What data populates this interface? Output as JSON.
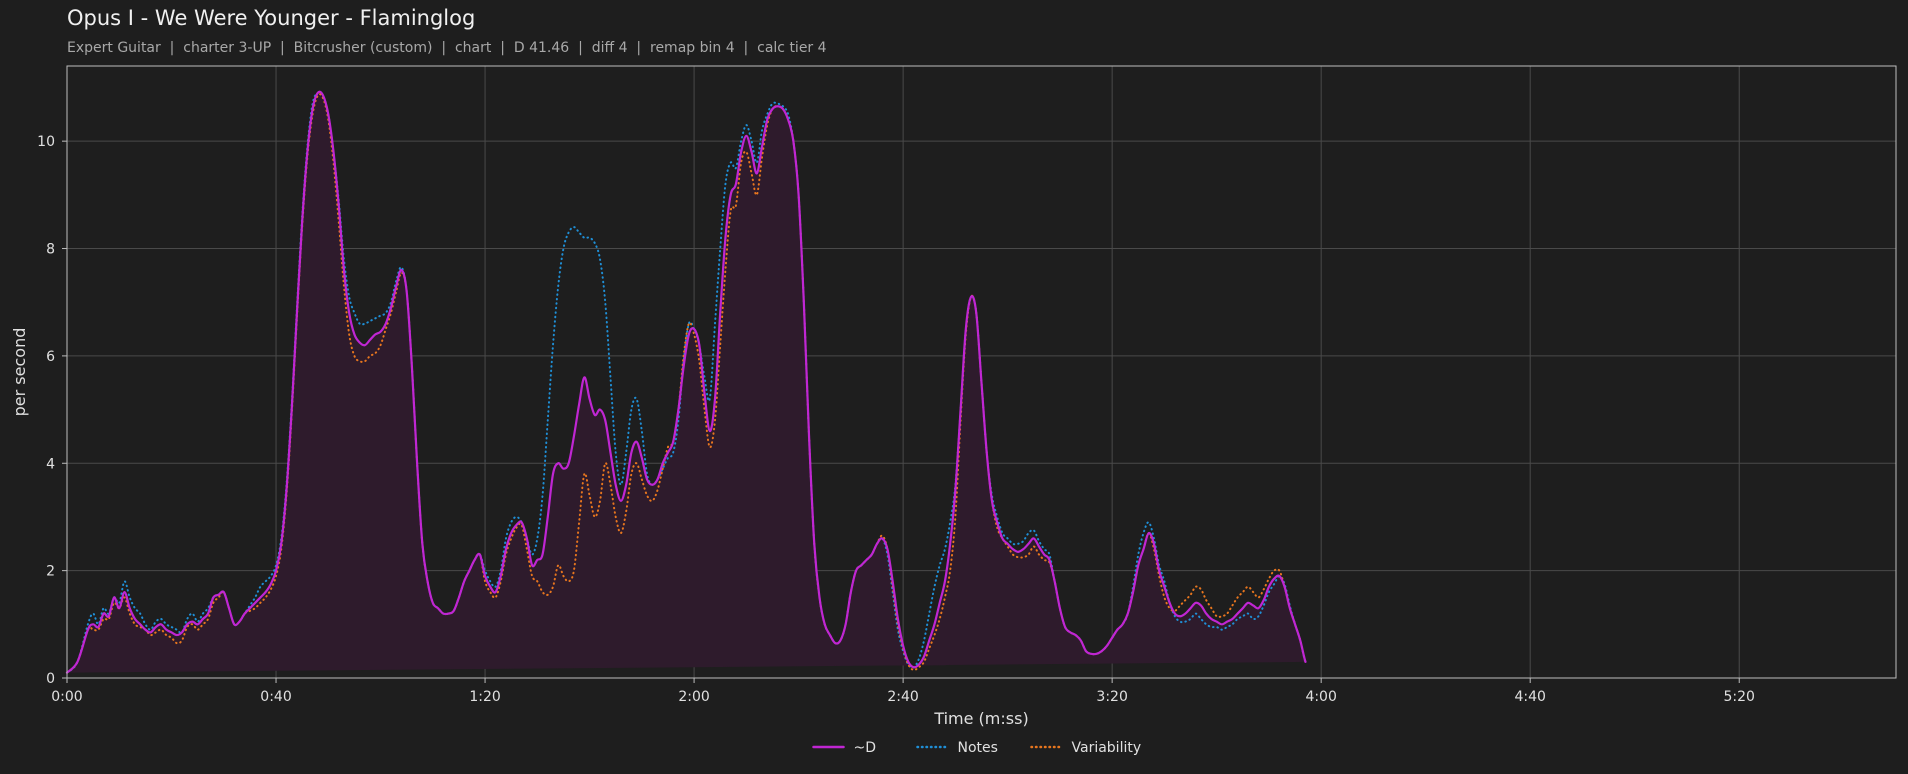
{
  "title": "Opus I - We Were Younger - Flaminglog",
  "subtitle": "Expert Guitar  |  charter 3-UP  |  Bitcrusher (custom)  |  chart  |  D 41.46  |  diff 4  |  remap bin 4  |  calc tier 4",
  "colors": {
    "background": "#1e1e1e",
    "grid": "#4a4a4a",
    "axis": "#bdbdbd",
    "d": "#c026d3",
    "d_fill": "#2e1b2c",
    "notes": "#1f8fd6",
    "variability": "#e8761e"
  },
  "chart_data": {
    "type": "line",
    "xlabel": "Time (m:ss)",
    "ylabel": "per second",
    "xlim": [
      0,
      350
    ],
    "ylim": [
      0,
      11.4
    ],
    "x_ticks": [
      0,
      40,
      80,
      120,
      160,
      200,
      240,
      280,
      320
    ],
    "x_tick_labels": [
      "0:00",
      "0:40",
      "1:20",
      "2:00",
      "2:40",
      "3:20",
      "4:00",
      "4:40",
      "5:20"
    ],
    "y_ticks": [
      0,
      2,
      4,
      6,
      8,
      10
    ],
    "y_tick_labels": [
      "0",
      "2",
      "4",
      "6",
      "8",
      "10"
    ],
    "grid": true,
    "legend_position": "bottom-center",
    "x": [
      0,
      2,
      4,
      5,
      6,
      7,
      8,
      9,
      10,
      11,
      12,
      13,
      14,
      15,
      16,
      17,
      18,
      19,
      20,
      21,
      22,
      23,
      24,
      25,
      26,
      27,
      28,
      29,
      30,
      31,
      32,
      33,
      34,
      35,
      36,
      37,
      38,
      39,
      40,
      41,
      42,
      43,
      44,
      45,
      46,
      47,
      48,
      49,
      50,
      51,
      52,
      53,
      54,
      55,
      56,
      57,
      58,
      59,
      60,
      61,
      62,
      63,
      64,
      65,
      66,
      67,
      68,
      69,
      70,
      71,
      72,
      73,
      74,
      75,
      76,
      77,
      78,
      79,
      80,
      81,
      82,
      83,
      84,
      85,
      86,
      87,
      88,
      89,
      90,
      91,
      92,
      93,
      94,
      95,
      96,
      97,
      98,
      99,
      100,
      101,
      102,
      103,
      104,
      105,
      106,
      107,
      108,
      109,
      110,
      111,
      112,
      113,
      114,
      115,
      116,
      117,
      118,
      119,
      120,
      121,
      122,
      123,
      124,
      125,
      126,
      127,
      128,
      129,
      130,
      131,
      132,
      133,
      134,
      135,
      136,
      137,
      138,
      139,
      140,
      141,
      142,
      143,
      144,
      145,
      146,
      147,
      148,
      149,
      150,
      151,
      152,
      153,
      154,
      155,
      156,
      157,
      158,
      159,
      160,
      161,
      162,
      163,
      164,
      165,
      166,
      167,
      168,
      169,
      170,
      171,
      172,
      173,
      174,
      175,
      176,
      177,
      178,
      179,
      180,
      181,
      182,
      183,
      184,
      185,
      186,
      187,
      188,
      189,
      190,
      191,
      192,
      193,
      194,
      195,
      196,
      197,
      198,
      199,
      200,
      201,
      202,
      203,
      204,
      205,
      206,
      207,
      208,
      209,
      210,
      211,
      212,
      213,
      214,
      215,
      216,
      217,
      218,
      219,
      220,
      221,
      222,
      223,
      224,
      225,
      226,
      227,
      228,
      229,
      230,
      231,
      232,
      233,
      234,
      235,
      236,
      237,
      238,
      239,
      240,
      241,
      242,
      243,
      244,
      245,
      246,
      247,
      248,
      249,
      250,
      251,
      252,
      253,
      254,
      255,
      256,
      257,
      258,
      259,
      260,
      261,
      262,
      263,
      264,
      265,
      266,
      267,
      268,
      269,
      270,
      271,
      272,
      273,
      274,
      275,
      276,
      277,
      278,
      279,
      280,
      281,
      282,
      283,
      284,
      285,
      286,
      287,
      288,
      289,
      290,
      291,
      292,
      293,
      294,
      295,
      296,
      297,
      298,
      299,
      300,
      301,
      302,
      303,
      304,
      305,
      306,
      307,
      308,
      309,
      310,
      311,
      312,
      313,
      314,
      315,
      316,
      317,
      318,
      319,
      320,
      321,
      322,
      323,
      324,
      325,
      326,
      327,
      328,
      329,
      330,
      331,
      332,
      333,
      334,
      335,
      336,
      337,
      338,
      339,
      340,
      341,
      342,
      343,
      344,
      345,
      346,
      347,
      348,
      349,
      350
    ],
    "series": [
      {
        "name": "~D",
        "style": "solid",
        "values": [
          0.1,
          0.3,
          0.9,
          1.0,
          0.95,
          1.2,
          1.15,
          1.5,
          1.3,
          1.6,
          1.3,
          1.1,
          1.0,
          0.9,
          0.85,
          0.95,
          1.0,
          0.9,
          0.85,
          0.8,
          0.85,
          1.0,
          1.05,
          1.0,
          1.1,
          1.2,
          1.5,
          1.55,
          1.6,
          1.3,
          1.0,
          1.05,
          1.2,
          1.3,
          1.4,
          1.5,
          1.6,
          1.75,
          2.0,
          2.5,
          3.5,
          5.0,
          6.8,
          8.5,
          9.8,
          10.6,
          10.9,
          10.85,
          10.5,
          9.8,
          8.8,
          7.6,
          6.8,
          6.4,
          6.25,
          6.2,
          6.3,
          6.4,
          6.45,
          6.6,
          6.9,
          7.3,
          7.6,
          7.2,
          5.8,
          4.0,
          2.5,
          1.8,
          1.4,
          1.3,
          1.2,
          1.2,
          1.25,
          1.5,
          1.8,
          2.0,
          2.2,
          2.3,
          1.9,
          1.7,
          1.6,
          1.9,
          2.4,
          2.7,
          2.85,
          2.9,
          2.6,
          2.1,
          2.2,
          2.3,
          3.0,
          3.8,
          4.0,
          3.9,
          4.0,
          4.5,
          5.1,
          5.6,
          5.2,
          4.9,
          5.0,
          4.8,
          4.2,
          3.6,
          3.3,
          3.6,
          4.2,
          4.4,
          4.1,
          3.7,
          3.6,
          3.7,
          4.0,
          4.2,
          4.4,
          5.0,
          5.8,
          6.4,
          6.5,
          6.2,
          5.3,
          4.6,
          5.2,
          6.8,
          8.2,
          9.0,
          9.2,
          9.8,
          10.1,
          9.8,
          9.4,
          9.9,
          10.4,
          10.6,
          10.65,
          10.6,
          10.4,
          10.0,
          9.0,
          7.0,
          4.5,
          2.5,
          1.5,
          1.0,
          0.8,
          0.65,
          0.7,
          1.0,
          1.6,
          2.0,
          2.1,
          2.2,
          2.3,
          2.5,
          2.6,
          2.4,
          1.8,
          1.1,
          0.6,
          0.3,
          0.2,
          0.25,
          0.4,
          0.7,
          1.0,
          1.4,
          1.8,
          2.5,
          3.5,
          5.0,
          6.5,
          7.1,
          6.8,
          5.5,
          4.2,
          3.3,
          2.9,
          2.6,
          2.5,
          2.4,
          2.35,
          2.4,
          2.5,
          2.6,
          2.45,
          2.3,
          2.2,
          1.8,
          1.3,
          0.95,
          0.85,
          0.8,
          0.7,
          0.5,
          0.45,
          0.45,
          0.5,
          0.6,
          0.75,
          0.9,
          1.0,
          1.2,
          1.6,
          2.1,
          2.4,
          2.7,
          2.5,
          2.0,
          1.7,
          1.4,
          1.2,
          1.15,
          1.2,
          1.3,
          1.4,
          1.35,
          1.2,
          1.1,
          1.05,
          1.0,
          1.05,
          1.1,
          1.2,
          1.3,
          1.4,
          1.35,
          1.3,
          1.45,
          1.7,
          1.85,
          1.9,
          1.7,
          1.3,
          1.0,
          0.7,
          0.3,
          0.1
        ]
      },
      {
        "name": "Notes",
        "style": "dotted",
        "values": [
          0.1,
          0.3,
          1.0,
          1.2,
          1.0,
          1.3,
          1.2,
          1.5,
          1.4,
          1.8,
          1.5,
          1.3,
          1.2,
          1.0,
          0.9,
          1.05,
          1.1,
          1.0,
          0.95,
          0.9,
          0.85,
          1.1,
          1.2,
          1.05,
          1.2,
          1.3,
          1.5,
          1.55,
          1.6,
          1.3,
          1.0,
          1.05,
          1.2,
          1.35,
          1.5,
          1.7,
          1.8,
          1.9,
          2.1,
          2.6,
          3.6,
          5.1,
          6.9,
          8.6,
          9.9,
          10.7,
          10.9,
          10.85,
          10.5,
          9.8,
          8.9,
          7.8,
          7.1,
          6.8,
          6.6,
          6.6,
          6.65,
          6.7,
          6.75,
          6.8,
          7.0,
          7.4,
          7.65,
          7.2,
          5.8,
          4.0,
          2.5,
          1.8,
          1.4,
          1.3,
          1.2,
          1.2,
          1.25,
          1.5,
          1.8,
          2.0,
          2.2,
          2.3,
          2.0,
          1.8,
          1.7,
          2.0,
          2.6,
          2.9,
          3.0,
          2.9,
          2.6,
          2.3,
          2.6,
          3.4,
          4.8,
          6.2,
          7.3,
          8.0,
          8.3,
          8.4,
          8.3,
          8.2,
          8.2,
          8.1,
          7.8,
          7.0,
          5.6,
          4.2,
          3.6,
          4.2,
          5.0,
          5.2,
          4.6,
          3.8,
          3.6,
          3.7,
          3.9,
          4.1,
          4.2,
          4.8,
          5.9,
          6.6,
          6.5,
          6.2,
          5.6,
          5.2,
          6.6,
          8.0,
          9.2,
          9.6,
          9.5,
          10.0,
          10.3,
          10.0,
          9.6,
          10.2,
          10.5,
          10.7,
          10.7,
          10.65,
          10.5,
          10.0,
          9.0,
          7.0,
          4.5,
          2.5,
          1.5,
          1.0,
          0.8,
          0.65,
          0.7,
          1.0,
          1.6,
          2.0,
          2.1,
          2.2,
          2.3,
          2.5,
          2.6,
          2.3,
          1.6,
          0.9,
          0.5,
          0.25,
          0.2,
          0.35,
          0.7,
          1.2,
          1.7,
          2.1,
          2.4,
          2.9,
          3.6,
          5.0,
          6.5,
          7.1,
          6.8,
          5.5,
          4.2,
          3.4,
          3.0,
          2.7,
          2.6,
          2.5,
          2.5,
          2.55,
          2.7,
          2.75,
          2.55,
          2.4,
          2.3,
          1.8,
          1.3,
          0.95,
          0.85,
          0.8,
          0.7,
          0.5,
          0.45,
          0.45,
          0.5,
          0.6,
          0.75,
          0.9,
          1.0,
          1.2,
          1.7,
          2.3,
          2.7,
          2.9,
          2.6,
          2.1,
          1.8,
          1.4,
          1.15,
          1.05,
          1.05,
          1.1,
          1.2,
          1.1,
          1.0,
          0.95,
          0.95,
          0.9,
          0.95,
          1.0,
          1.1,
          1.15,
          1.2,
          1.1,
          1.15,
          1.35,
          1.6,
          1.75,
          1.9,
          1.75,
          1.35,
          1.0,
          0.7,
          0.3,
          0.25
        ]
      },
      {
        "name": "Variability",
        "style": "dotted",
        "values": [
          0.1,
          0.3,
          0.9,
          0.9,
          0.9,
          1.1,
          1.1,
          1.4,
          1.3,
          1.5,
          1.2,
          1.0,
          0.95,
          0.9,
          0.8,
          0.85,
          0.9,
          0.8,
          0.75,
          0.65,
          0.7,
          0.95,
          1.0,
          0.9,
          1.0,
          1.1,
          1.4,
          1.5,
          1.6,
          1.3,
          1.0,
          1.05,
          1.2,
          1.25,
          1.3,
          1.4,
          1.5,
          1.65,
          1.9,
          2.4,
          3.4,
          4.9,
          6.7,
          8.4,
          9.7,
          10.5,
          10.85,
          10.8,
          10.4,
          9.6,
          8.5,
          7.3,
          6.4,
          6.0,
          5.9,
          5.9,
          6.0,
          6.05,
          6.2,
          6.5,
          6.8,
          7.2,
          7.55,
          7.2,
          5.8,
          4.0,
          2.5,
          1.8,
          1.4,
          1.3,
          1.2,
          1.2,
          1.25,
          1.5,
          1.8,
          2.0,
          2.2,
          2.3,
          1.8,
          1.6,
          1.5,
          1.8,
          2.3,
          2.6,
          2.8,
          2.85,
          2.4,
          1.9,
          1.8,
          1.6,
          1.55,
          1.7,
          2.1,
          1.9,
          1.8,
          2.0,
          2.9,
          3.8,
          3.4,
          3.0,
          3.3,
          4.0,
          3.6,
          3.0,
          2.7,
          3.1,
          3.8,
          4.0,
          3.7,
          3.4,
          3.3,
          3.5,
          3.9,
          4.3,
          4.4,
          5.0,
          6.0,
          6.6,
          6.4,
          5.9,
          5.0,
          4.3,
          4.8,
          6.2,
          7.6,
          8.7,
          8.8,
          9.6,
          9.8,
          9.4,
          9.0,
          9.7,
          10.3,
          10.6,
          10.65,
          10.6,
          10.4,
          10.0,
          9.0,
          7.0,
          4.5,
          2.5,
          1.5,
          1.0,
          0.8,
          0.65,
          0.7,
          1.0,
          1.6,
          2.0,
          2.1,
          2.2,
          2.3,
          2.5,
          2.65,
          2.4,
          1.7,
          1.0,
          0.55,
          0.25,
          0.15,
          0.2,
          0.3,
          0.55,
          0.8,
          1.1,
          1.5,
          2.0,
          3.0,
          4.8,
          6.4,
          7.1,
          6.8,
          5.5,
          4.2,
          3.3,
          2.8,
          2.6,
          2.45,
          2.3,
          2.25,
          2.25,
          2.3,
          2.45,
          2.3,
          2.2,
          2.15,
          1.8,
          1.3,
          0.95,
          0.85,
          0.8,
          0.7,
          0.5,
          0.45,
          0.45,
          0.5,
          0.6,
          0.75,
          0.9,
          1.0,
          1.2,
          1.6,
          2.1,
          2.4,
          2.7,
          2.4,
          1.9,
          1.5,
          1.3,
          1.25,
          1.35,
          1.45,
          1.55,
          1.7,
          1.65,
          1.45,
          1.3,
          1.15,
          1.15,
          1.2,
          1.35,
          1.5,
          1.6,
          1.7,
          1.6,
          1.5,
          1.65,
          1.85,
          2.0,
          2.0,
          1.7,
          1.3,
          1.0,
          0.7,
          0.3,
          0.1
        ]
      }
    ]
  }
}
